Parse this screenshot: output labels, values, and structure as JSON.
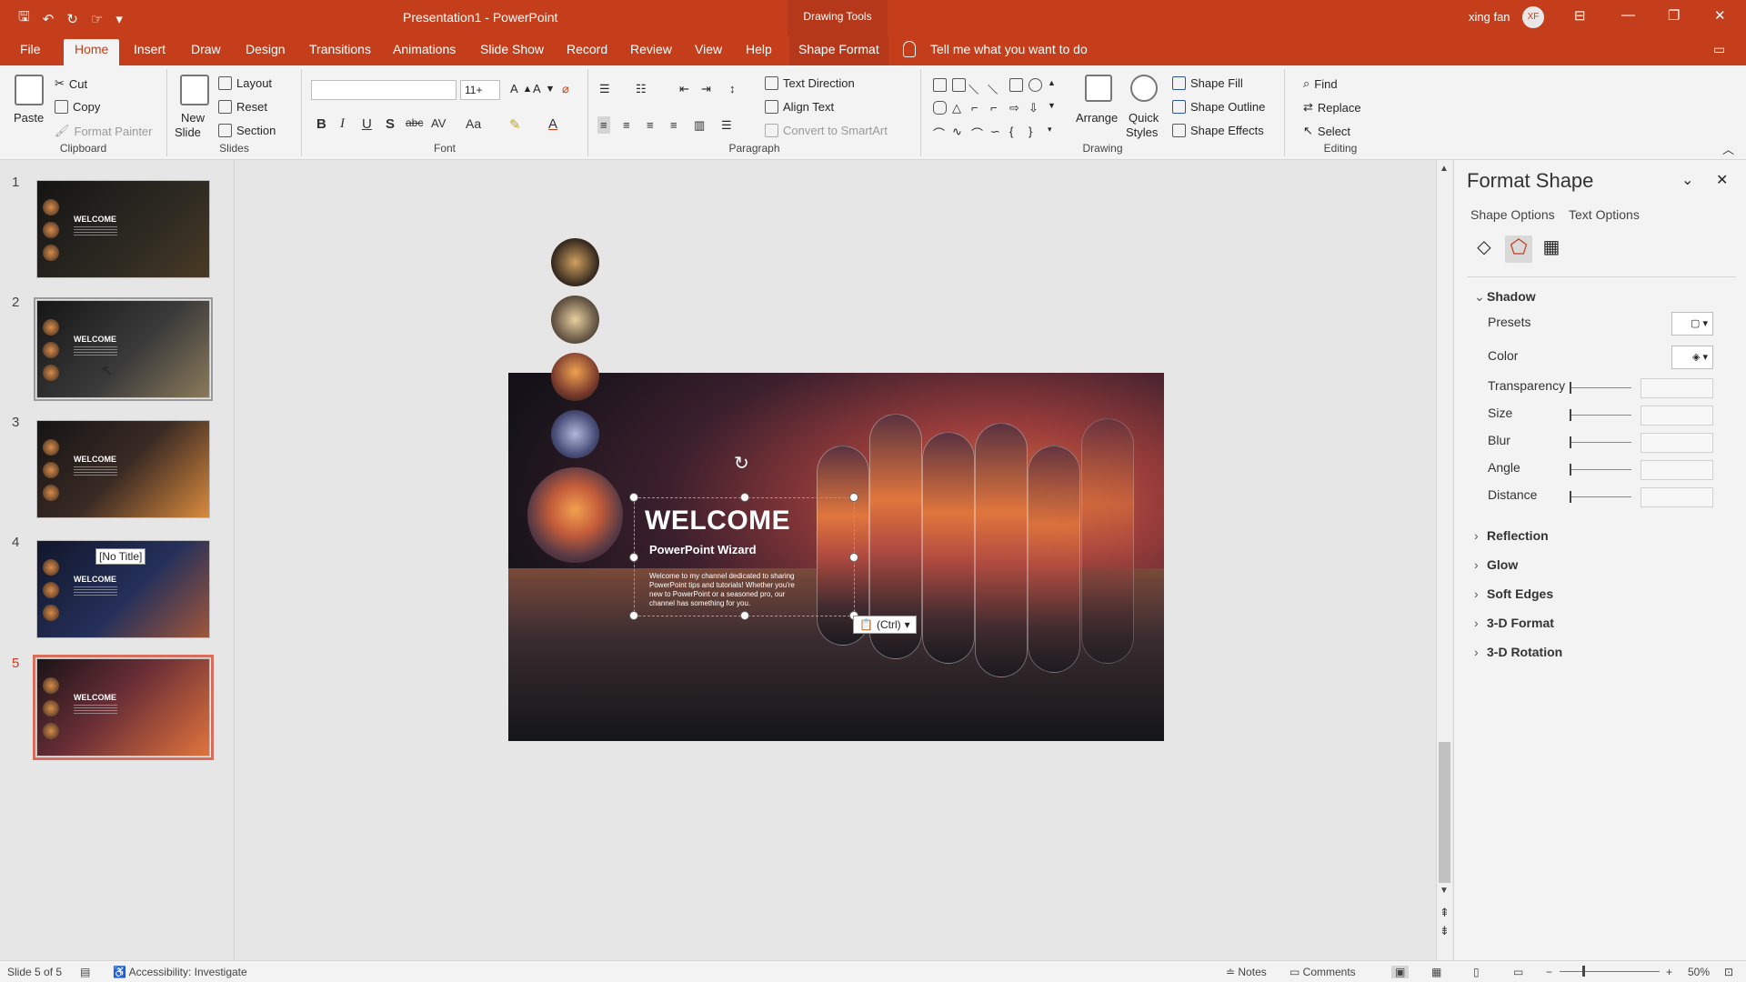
{
  "window": {
    "doc_title": "Presentation1  -  PowerPoint",
    "contextual_group": "Drawing Tools",
    "user_name": "xing fan",
    "user_initials": "XF"
  },
  "tabs": [
    "File",
    "Home",
    "Insert",
    "Draw",
    "Design",
    "Transitions",
    "Animations",
    "Slide Show",
    "Record",
    "Review",
    "View",
    "Help",
    "Shape Format"
  ],
  "active_tab": "Home",
  "tell_me": "Tell me what you want to do",
  "ribbon": {
    "clipboard": {
      "paste": "Paste",
      "cut": "Cut",
      "copy": "Copy",
      "format_painter": "Format Painter",
      "label": "Clipboard"
    },
    "slides": {
      "new_slide_1": "New",
      "new_slide_2": "Slide",
      "layout": "Layout",
      "reset": "Reset",
      "section": "Section",
      "label": "Slides"
    },
    "font": {
      "size": "11+",
      "label": "Font",
      "bold": "B",
      "italic": "I",
      "underline": "U",
      "shadow": "S",
      "strike": "abc",
      "spacing": "AV",
      "case": "Aa",
      "color": "A"
    },
    "paragraph": {
      "text_direction": "Text Direction",
      "align_text": "Align Text",
      "smartart": "Convert to SmartArt",
      "label": "Paragraph"
    },
    "drawing": {
      "arrange": "Arrange",
      "quick_styles_1": "Quick",
      "quick_styles_2": "Styles",
      "shape_fill": "Shape Fill",
      "shape_outline": "Shape Outline",
      "shape_effects": "Shape Effects",
      "label": "Drawing"
    },
    "editing": {
      "find": "Find",
      "replace": "Replace",
      "select": "Select",
      "label": "Editing"
    }
  },
  "thumbnails": {
    "numbers": [
      "1",
      "2",
      "3",
      "4",
      "5"
    ],
    "title_text": "WELCOME",
    "hover_tooltip": "[No Title]",
    "selected_index": 5
  },
  "slide": {
    "title": "WELCOME",
    "subtitle": "PowerPoint Wizard",
    "body": "Welcome to my channel dedicated to sharing PowerPoint tips and tutorials! Whether you're new to PowerPoint or a seasoned pro, our channel has something for you.",
    "paste_options": "(Ctrl)"
  },
  "format_pane": {
    "title": "Format Shape",
    "shape_options": "Shape Options",
    "text_options": "Text Options",
    "shadow": "Shadow",
    "presets": "Presets",
    "color": "Color",
    "transparency": "Transparency",
    "size": "Size",
    "blur": "Blur",
    "angle": "Angle",
    "distance": "Distance",
    "reflection": "Reflection",
    "glow": "Glow",
    "soft_edges": "Soft Edges",
    "format_3d": "3-D Format",
    "rotation_3d": "3-D Rotation"
  },
  "status": {
    "slide_info": "Slide 5 of 5",
    "accessibility": "Accessibility: Investigate",
    "notes": "Notes",
    "comments": "Comments",
    "zoom": "50%"
  },
  "colors": {
    "accent": "#c43e1c",
    "selection": "#d96c5a"
  },
  "icons": [
    "save-icon",
    "undo-icon",
    "redo-icon",
    "lightbulb-icon",
    "cut-icon",
    "copy-icon",
    "paste-icon",
    "rotate-icon",
    "close-icon",
    "chevron-down-icon",
    "fill-line-icon",
    "effects-icon",
    "size-properties-icon"
  ]
}
